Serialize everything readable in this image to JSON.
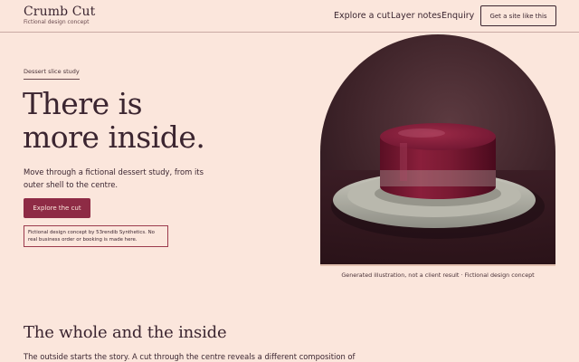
{
  "header": {
    "brand_name": "Crumb Cut",
    "brand_tagline": "Fictional design concept",
    "nav": [
      "Explore a cut",
      "Layer notes",
      "Enquiry"
    ],
    "cta_label": "Get a site like this"
  },
  "hero": {
    "eyebrow": "Dessert slice study",
    "title_line1": "There is",
    "title_line2": "more inside.",
    "body": "Move through a fictional dessert study, from its outer shell to the centre.",
    "button_label": "Explore the cut",
    "notice": "Fictional design concept by 53rendib Synthetics. No real business order or booking is made here.",
    "image_caption": "Generated illustration, not a client result · Fictional design concept"
  },
  "section": {
    "title": "The whole and the inside",
    "body": "The outside starts the story. A cut through the centre reveals a different composition of"
  },
  "colors": {
    "background": "#fbe6dc",
    "text": "#3b2530",
    "accent": "#8e2b45"
  }
}
